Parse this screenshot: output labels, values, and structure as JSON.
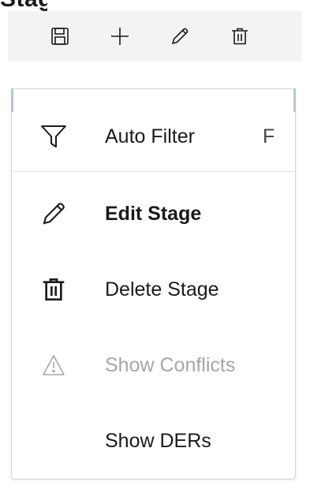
{
  "header": {
    "title_fragment": "Stage"
  },
  "toolbar": {
    "buttons": [
      {
        "name": "save",
        "icon": "save-icon"
      },
      {
        "name": "add",
        "icon": "plus-icon"
      },
      {
        "name": "edit",
        "icon": "pencil-icon"
      },
      {
        "name": "delete",
        "icon": "trash-icon"
      }
    ]
  },
  "menu": {
    "items": [
      {
        "label": "Auto Filter",
        "shortcut": "F",
        "icon": "filter-icon",
        "enabled": true,
        "bold": false
      },
      {
        "label": "Edit Stage",
        "shortcut": "",
        "icon": "pencil-icon",
        "enabled": true,
        "bold": true
      },
      {
        "label": "Delete Stage",
        "shortcut": "",
        "icon": "trash-icon",
        "enabled": true,
        "bold": false
      },
      {
        "label": "Show Conflicts",
        "shortcut": "",
        "icon": "warning-icon",
        "enabled": false,
        "bold": false
      },
      {
        "label": "Show DERs",
        "shortcut": "",
        "icon": "",
        "enabled": true,
        "bold": false
      }
    ]
  },
  "colors": {
    "toolbar_bg": "#f3f3f3",
    "text": "#1b1b1b",
    "disabled_text": "#a6a6a6",
    "menu_border": "#d6d6d6"
  }
}
